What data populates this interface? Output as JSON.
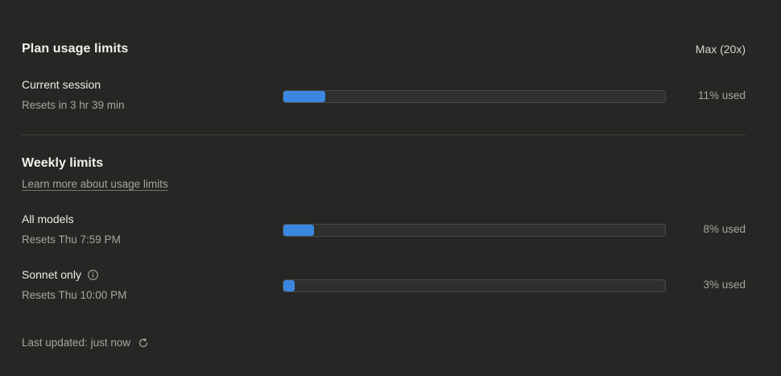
{
  "plan": {
    "title": "Plan usage limits",
    "badge": "Max (20x)"
  },
  "current_session": {
    "name": "Current session",
    "reset": "Resets in 3 hr 39 min",
    "used_label": "11% used",
    "used_fraction": 0.11
  },
  "weekly": {
    "title": "Weekly limits",
    "learn_more": "Learn more about usage limits",
    "items": [
      {
        "name": "All models",
        "reset": "Resets Thu 7:59 PM",
        "used_label": "8% used",
        "used_fraction": 0.08
      },
      {
        "name": "Sonnet only",
        "reset": "Resets Thu 10:00 PM",
        "used_label": "3% used",
        "used_fraction": 0.03
      }
    ]
  },
  "footer": {
    "last_updated": "Last updated: just now"
  },
  "colors": {
    "background": "#262624",
    "bar_fill": "#3a86e0",
    "bar_track": "#2f2f2d"
  },
  "icons": {
    "info": "info-icon",
    "refresh": "refresh-icon"
  }
}
